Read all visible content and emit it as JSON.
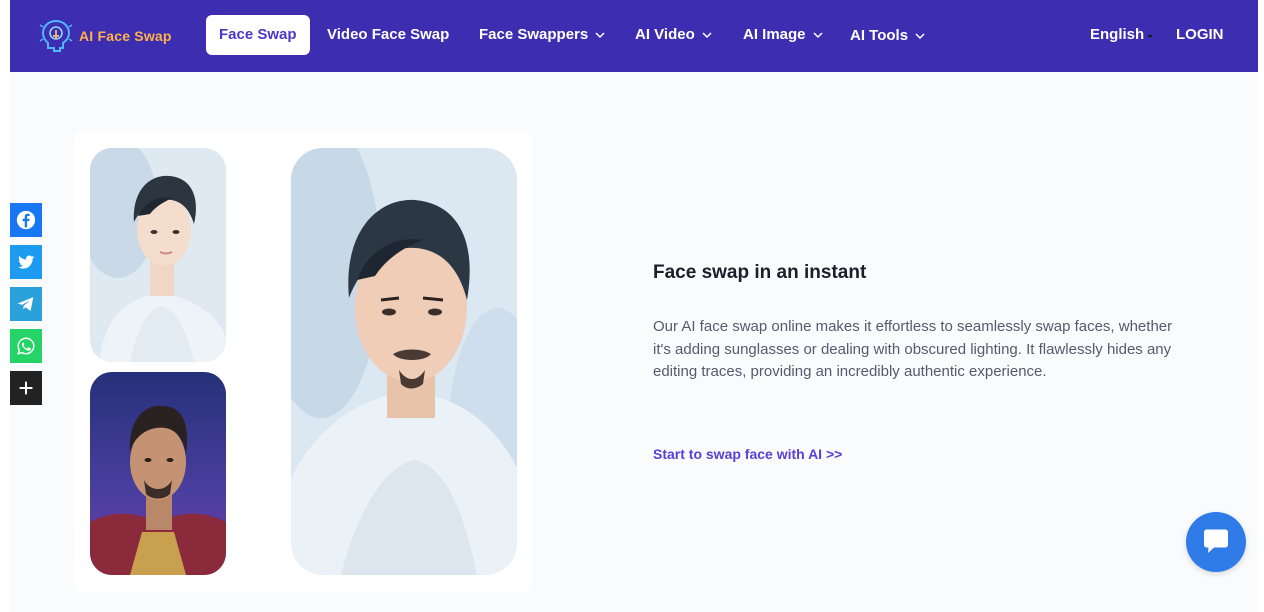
{
  "brand": {
    "name": "AI Face Swap",
    "logo_icon": "face-bulb-icon"
  },
  "nav": {
    "items": [
      {
        "label": "Face Swap",
        "active": true,
        "dropdown": false
      },
      {
        "label": "Video Face Swap",
        "active": false,
        "dropdown": false
      },
      {
        "label": "Face Swappers",
        "active": false,
        "dropdown": true
      },
      {
        "label": "AI Video",
        "active": false,
        "dropdown": true
      },
      {
        "label": "AI Image",
        "active": false,
        "dropdown": true
      },
      {
        "label": "AI Tools",
        "active": false,
        "dropdown": true
      }
    ],
    "language": "English",
    "login": "LOGIN"
  },
  "share_bar": {
    "items": [
      {
        "icon": "facebook-icon",
        "color": "#1877f2"
      },
      {
        "icon": "twitter-icon",
        "color": "#1d9bf0"
      },
      {
        "icon": "telegram-icon",
        "color": "#2aa1da"
      },
      {
        "icon": "whatsapp-icon",
        "color": "#25d366"
      },
      {
        "icon": "plus-icon",
        "color": "#222222"
      }
    ]
  },
  "feature": {
    "title": "Face swap in an instant",
    "description": "Our AI face swap online makes it effortless to seamlessly swap faces, whether it's adding sunglasses or dealing with obscured lighting. It flawlessly hides any editing traces, providing an incredibly authentic experience.",
    "cta": "Start to swap face with AI >>"
  },
  "colors": {
    "nav_bg": "#3d2db0",
    "accent": "#5a3fd6",
    "logo_text": "#ffb24a",
    "chat": "#2f7be8"
  },
  "chat_widget": {
    "icon": "chat-bubble-icon"
  }
}
